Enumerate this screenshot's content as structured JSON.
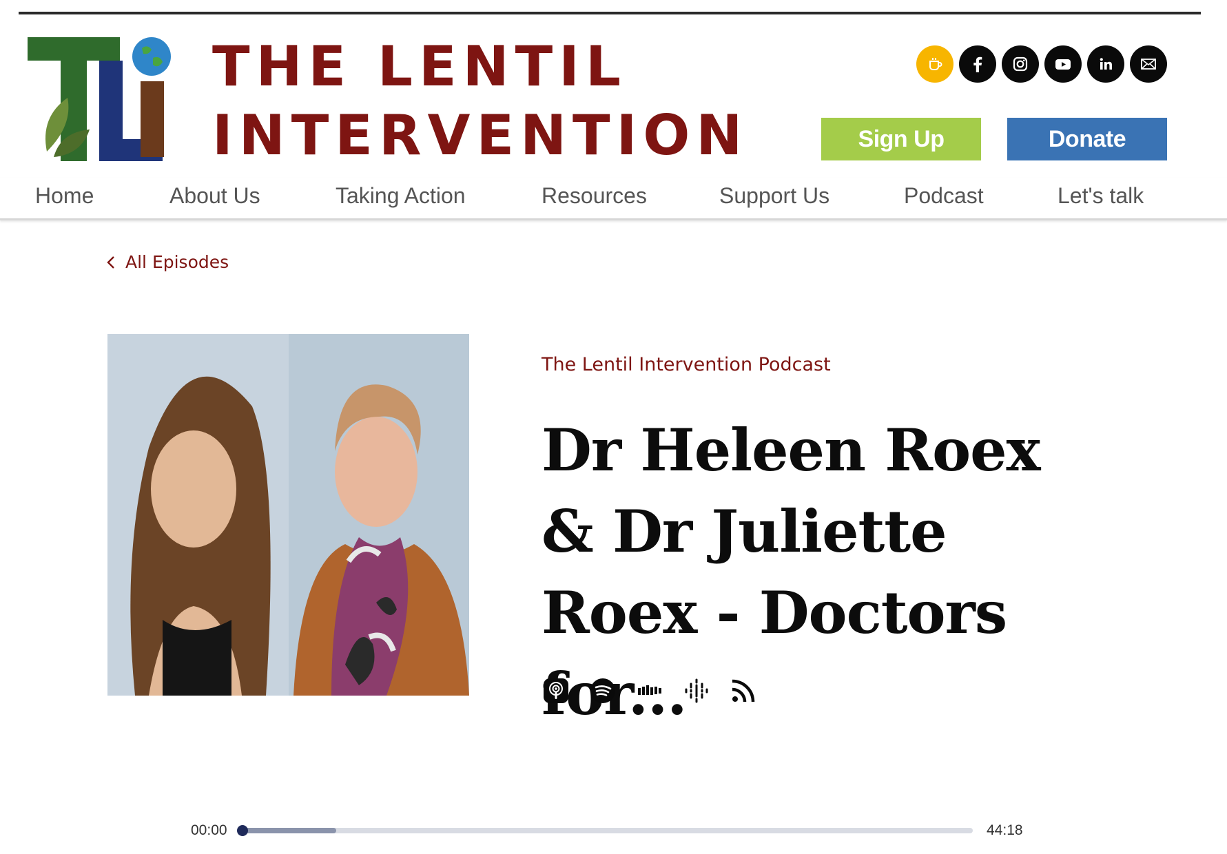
{
  "header": {
    "brand_line_1": "THE LENTIL",
    "brand_line_2": "INTERVENTION",
    "logo_letters": "TLi",
    "social": [
      {
        "name": "coffee-icon",
        "color": "#f7b500"
      },
      {
        "name": "facebook-icon",
        "color": "#0a0a0a"
      },
      {
        "name": "instagram-icon",
        "color": "#0a0a0a"
      },
      {
        "name": "youtube-icon",
        "color": "#0a0a0a"
      },
      {
        "name": "linkedin-icon",
        "color": "#0a0a0a"
      },
      {
        "name": "email-icon",
        "color": "#0a0a0a"
      }
    ],
    "signup_label": "Sign Up",
    "donate_label": "Donate"
  },
  "nav": {
    "items": [
      "Home",
      "About Us",
      "Taking Action",
      "Resources",
      "Support Us",
      "Podcast",
      "Let's talk"
    ]
  },
  "episode": {
    "back_label": "All Episodes",
    "show_name": "The Lentil Intervention Podcast",
    "title": "Dr Heleen Roex & Dr Juliette Roex - Doctors for...",
    "platforms": [
      "apple-podcasts-icon",
      "spotify-icon",
      "castbox-icon",
      "google-podcasts-icon",
      "rss-icon"
    ]
  },
  "player": {
    "current_time": "00:00",
    "total_time": "44:18",
    "progress_fraction": 0.0,
    "buffered_fraction": 0.13
  },
  "colors": {
    "brand": "#7e1512",
    "signup": "#a4cc4a",
    "donate": "#3a73b4",
    "coffee": "#f7b500"
  }
}
